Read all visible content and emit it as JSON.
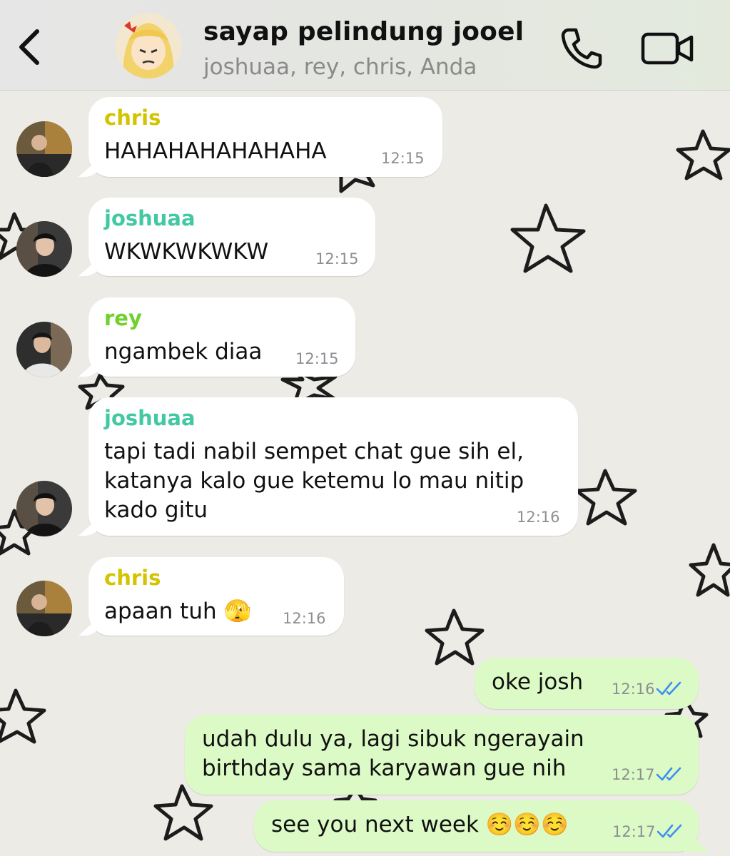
{
  "header": {
    "group_name": "sayap pelindung jooel",
    "members": "joshuaa, rey, chris, Anda"
  },
  "colors": {
    "chris": "#d4c300",
    "joshuaa": "#43c8a4",
    "rey": "#6fd12c",
    "outgoing_bubble": "#dcfac6",
    "incoming_bubble": "#ffffff",
    "read_ticks": "#3b8ff2"
  },
  "messages": [
    {
      "sender": "chris",
      "text": "HAHAHAHAHAHAHA",
      "time": "12:15"
    },
    {
      "sender": "joshuaa",
      "text": "WKWKWKWKW",
      "time": "12:15"
    },
    {
      "sender": "rey",
      "text": "ngambek diaa",
      "time": "12:15"
    },
    {
      "sender": "joshuaa",
      "text": "tapi tadi nabil sempet chat gue sih el,\nkatanya kalo gue ketemu lo mau nitip\nkado gitu",
      "time": "12:16"
    },
    {
      "sender": "chris",
      "text": "apaan tuh 🫣",
      "time": "12:16"
    },
    {
      "sender": "me",
      "text": "oke josh",
      "time": "12:16",
      "status": "read"
    },
    {
      "sender": "me",
      "text": "udah dulu ya, lagi sibuk ngerayain\nbirthday sama karyawan gue nih",
      "time": "12:17",
      "status": "read"
    },
    {
      "sender": "me",
      "text": "see you next week ☺️☺️☺️",
      "time": "12:17",
      "status": "read"
    }
  ],
  "icons": [
    "back-chevron-icon",
    "phone-icon",
    "video-camera-icon",
    "double-check-icon"
  ]
}
